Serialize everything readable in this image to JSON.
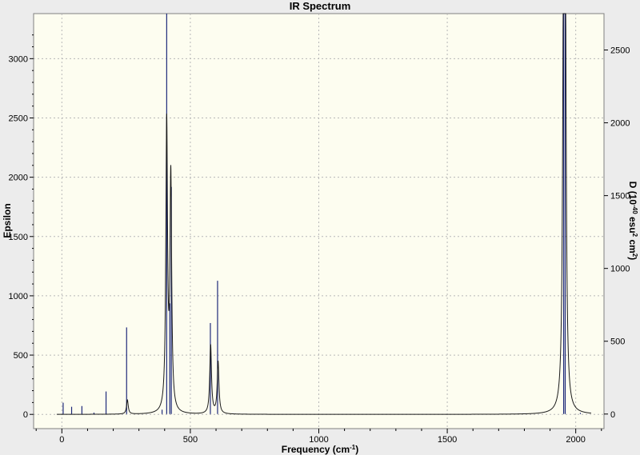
{
  "chart_data": {
    "type": "line",
    "title": "IR Spectrum",
    "xlabel": "Frequency (cm",
    "xlabel_sup": "-1",
    "xlabel_end": ")",
    "ylabel": "Epsilon",
    "y2label_parts": [
      "D (10",
      "-40",
      " esu",
      "2",
      " cm",
      "2",
      ")"
    ],
    "xlim": [
      -110,
      2110
    ],
    "ylim": [
      -120,
      3380
    ],
    "y2lim": [
      -100,
      2750
    ],
    "xticks": [
      0,
      500,
      1000,
      1500,
      2000
    ],
    "yticks": [
      0,
      500,
      1000,
      1500,
      2000,
      2500,
      3000
    ],
    "y2ticks": [
      0,
      500,
      1000,
      1500,
      2000,
      2500
    ],
    "grid": true,
    "x_range_drawn": [
      -20,
      2060
    ],
    "series": [
      {
        "kind": "lorentzian-spectrum",
        "axis": "left",
        "color": "#1a1a1a",
        "halfwidth": 4,
        "baseline": 0,
        "peaks": [
          {
            "x": 255,
            "y": 120
          },
          {
            "x": 408,
            "y": 2420
          },
          {
            "x": 424,
            "y": 1960
          },
          {
            "x": 579,
            "y": 580
          },
          {
            "x": 608,
            "y": 440
          },
          {
            "x": 1953,
            "y": 3600
          },
          {
            "x": 1959,
            "y": 3600
          }
        ]
      },
      {
        "kind": "sticks",
        "axis": "right",
        "color": "#1f2a7a",
        "sticks": [
          {
            "x": 5,
            "y": 78
          },
          {
            "x": 38,
            "y": 50
          },
          {
            "x": 78,
            "y": 55
          },
          {
            "x": 125,
            "y": 10
          },
          {
            "x": 172,
            "y": 155
          },
          {
            "x": 252,
            "y": 595
          },
          {
            "x": 390,
            "y": 30
          },
          {
            "x": 408,
            "y": 2760
          },
          {
            "x": 420,
            "y": 760
          },
          {
            "x": 426,
            "y": 1560
          },
          {
            "x": 578,
            "y": 625
          },
          {
            "x": 606,
            "y": 915
          },
          {
            "x": 1953,
            "y": 2760
          },
          {
            "x": 1959,
            "y": 2760
          },
          {
            "x": 2018,
            "y": 8
          }
        ]
      }
    ]
  }
}
